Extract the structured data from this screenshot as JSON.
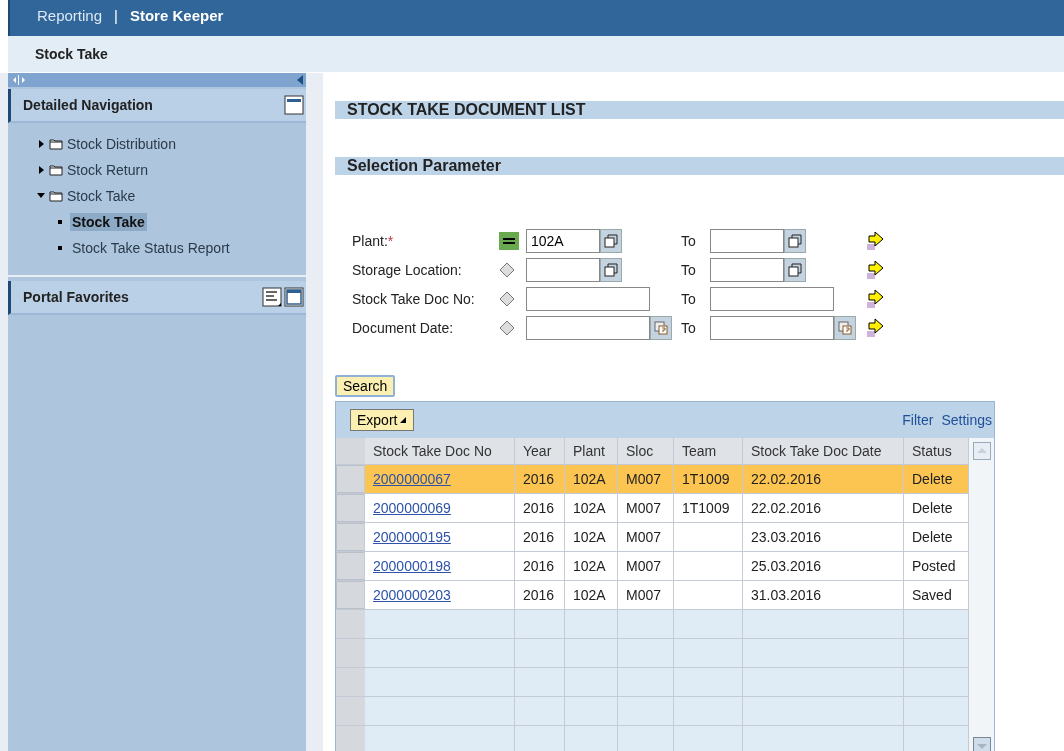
{
  "header": {
    "tabs": [
      {
        "label": "Reporting",
        "selected": false
      },
      {
        "label": "Store Keeper",
        "selected": true
      }
    ],
    "separator": "|"
  },
  "page_title": "Stock Take",
  "sidebar": {
    "panels": [
      {
        "title": "Detailed Navigation",
        "expanded": true,
        "items": [
          {
            "label": "Stock Distribution",
            "expanded": false
          },
          {
            "label": "Stock Return",
            "expanded": false
          },
          {
            "label": "Stock Take",
            "expanded": true,
            "children": [
              {
                "label": "Stock Take",
                "selected": true
              },
              {
                "label": "Stock Take Status Report",
                "selected": false
              }
            ]
          }
        ]
      },
      {
        "title": "Portal Favorites",
        "expanded": false
      }
    ]
  },
  "main": {
    "title": "STOCK TAKE DOCUMENT LIST",
    "selection": {
      "title": "Selection Parameter",
      "fields": [
        {
          "label": "Plant:",
          "required_mark": "*",
          "operator_set": true,
          "from": {
            "value": "102A",
            "kind": "select"
          },
          "to_label": "To",
          "to": {
            "kind": "select"
          }
        },
        {
          "label": "Storage Location:",
          "operator_set": false,
          "from": {
            "kind": "select"
          },
          "to_label": "To",
          "to": {
            "kind": "select"
          }
        },
        {
          "label": "Stock Take Doc No:",
          "operator_set": false,
          "from": {
            "kind": "text"
          },
          "to_label": "To",
          "to": {
            "kind": "text"
          }
        },
        {
          "label": "Document Date:",
          "operator_set": false,
          "from": {
            "kind": "date"
          },
          "to_label": "To",
          "to": {
            "kind": "date"
          }
        }
      ]
    },
    "search_button": "Search",
    "table": {
      "export_button": "Export",
      "links": [
        "Filter",
        "Settings"
      ],
      "columns": [
        "Stock Take Doc No",
        "Year",
        "Plant",
        "Sloc",
        "Team",
        "Stock Take Doc Date",
        "Status"
      ],
      "rows": [
        {
          "selected": true,
          "cells": [
            "2000000067",
            "2016",
            "102A",
            "M007",
            "1T1009",
            "22.02.2016",
            "Delete"
          ]
        },
        {
          "selected": false,
          "cells": [
            "2000000069",
            "2016",
            "102A",
            "M007",
            "1T1009",
            "22.02.2016",
            "Delete"
          ]
        },
        {
          "selected": false,
          "cells": [
            "2000000195",
            "2016",
            "102A",
            "M007",
            "",
            "23.03.2016",
            "Delete"
          ]
        },
        {
          "selected": false,
          "cells": [
            "2000000198",
            "2016",
            "102A",
            "M007",
            "",
            "25.03.2016",
            "Posted"
          ]
        },
        {
          "selected": false,
          "cells": [
            "2000000203",
            "2016",
            "102A",
            "M007",
            "",
            "31.03.2016",
            "Saved"
          ]
        }
      ]
    }
  }
}
